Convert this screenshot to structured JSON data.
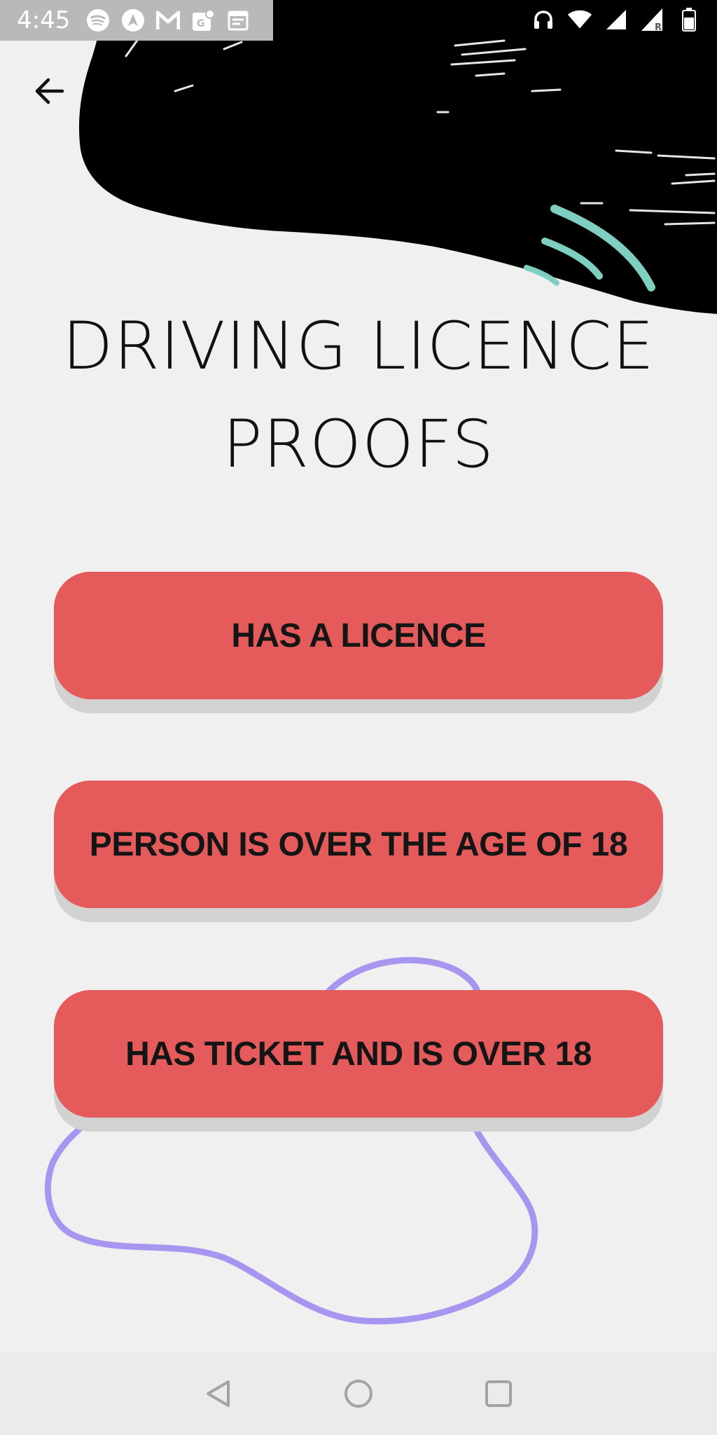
{
  "status_bar": {
    "time": "4:45",
    "left_icons": [
      "spotify-icon",
      "navigation-icon",
      "gmail-icon",
      "maps-icon",
      "calendar-icon"
    ],
    "right_icons": [
      "headphones-icon",
      "wifi-icon",
      "signal-icon",
      "signal-roaming-icon",
      "battery-icon"
    ],
    "roaming_label": "R"
  },
  "header": {
    "back_icon": "arrow-left-icon"
  },
  "title": {
    "line1": "DRIVING LICENCE",
    "line2": "PROOFS"
  },
  "options": [
    {
      "label": "HAS A LICENCE"
    },
    {
      "label": "PERSON IS OVER THE AGE OF 18"
    },
    {
      "label": "HAS TICKET AND IS OVER 18"
    }
  ],
  "colors": {
    "background": "#f0f0f1",
    "button": "#e55b5b",
    "button_shadow": "#d2d2d2",
    "brush_black": "#000000",
    "accent_teal": "#7ecfc0",
    "accent_purple": "#a895f0"
  },
  "nav_bar": {
    "icons": [
      "back-triangle-icon",
      "home-circle-icon",
      "recents-square-icon"
    ]
  }
}
